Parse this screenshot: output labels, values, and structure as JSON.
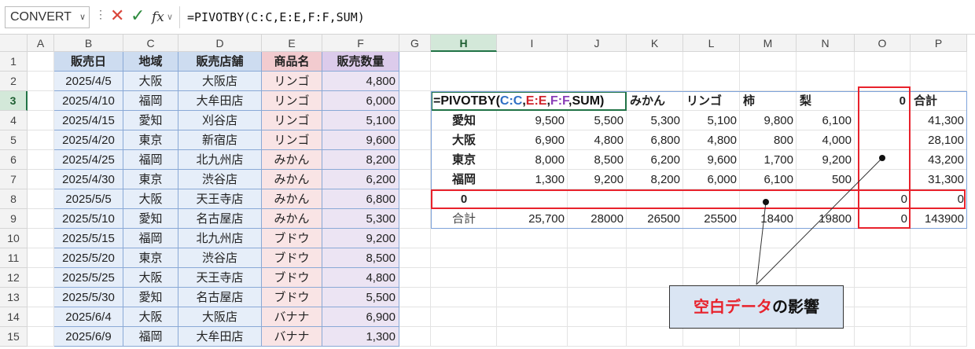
{
  "formula_bar": {
    "name_box": "CONVERT",
    "formula": "=PIVOTBY(C:C,E:E,F:F,SUM)"
  },
  "columns": [
    "A",
    "B",
    "C",
    "D",
    "E",
    "F",
    "G",
    "H",
    "I",
    "J",
    "K",
    "L",
    "M",
    "N",
    "O",
    "P"
  ],
  "selected_column": "H",
  "selected_row": "3",
  "rows": [
    "1",
    "2",
    "3",
    "4",
    "5",
    "6",
    "7",
    "8",
    "9",
    "10",
    "11",
    "12",
    "13",
    "14",
    "15"
  ],
  "table": {
    "headers": [
      "販売日",
      "地域",
      "販売店舗",
      "商品名",
      "販売数量"
    ],
    "data": [
      [
        "2025/4/5",
        "大阪",
        "大阪店",
        "リンゴ",
        "4,800"
      ],
      [
        "2025/4/10",
        "福岡",
        "大牟田店",
        "リンゴ",
        "6,000"
      ],
      [
        "2025/4/15",
        "愛知",
        "刈谷店",
        "リンゴ",
        "5,100"
      ],
      [
        "2025/4/20",
        "東京",
        "新宿店",
        "リンゴ",
        "9,600"
      ],
      [
        "2025/4/25",
        "福岡",
        "北九州店",
        "みかん",
        "8,200"
      ],
      [
        "2025/4/30",
        "東京",
        "渋谷店",
        "みかん",
        "6,200"
      ],
      [
        "2025/5/5",
        "大阪",
        "天王寺店",
        "みかん",
        "6,800"
      ],
      [
        "2025/5/10",
        "愛知",
        "名古屋店",
        "みかん",
        "5,300"
      ],
      [
        "2025/5/15",
        "福岡",
        "北九州店",
        "ブドウ",
        "9,200"
      ],
      [
        "2025/5/20",
        "東京",
        "渋谷店",
        "ブドウ",
        "8,500"
      ],
      [
        "2025/5/25",
        "大阪",
        "天王寺店",
        "ブドウ",
        "4,800"
      ],
      [
        "2025/5/30",
        "愛知",
        "名古屋店",
        "ブドウ",
        "5,500"
      ],
      [
        "2025/6/4",
        "大阪",
        "大阪店",
        "バナナ",
        "6,900"
      ],
      [
        "2025/6/9",
        "福岡",
        "大牟田店",
        "バナナ",
        "1,300"
      ]
    ]
  },
  "pivot": {
    "formula_prefix": "=PIVOTBY(",
    "formula_c": "C:C",
    "comma1": ",",
    "formula_e": "E:E",
    "comma2": ",",
    "formula_f": "F:F",
    "formula_suffix": ",SUM)",
    "col_headers": [
      "みかん",
      "リンゴ",
      "柿",
      "梨",
      "0",
      "合計"
    ],
    "rows": [
      {
        "label": "愛知",
        "values": [
          "9,500",
          "5,500",
          "5,300",
          "5,100",
          "9,800",
          "6,100",
          "",
          "41,300"
        ]
      },
      {
        "label": "大阪",
        "values": [
          "6,900",
          "4,800",
          "6,800",
          "4,800",
          "800",
          "4,000",
          "",
          "28,100"
        ]
      },
      {
        "label": "東京",
        "values": [
          "8,000",
          "8,500",
          "6,200",
          "9,600",
          "1,700",
          "9,200",
          "",
          "43,200"
        ]
      },
      {
        "label": "福岡",
        "values": [
          "1,300",
          "9,200",
          "8,200",
          "6,000",
          "6,100",
          "500",
          "",
          "31,300"
        ]
      },
      {
        "label": "0",
        "values": [
          "",
          "",
          "",
          "",
          "",
          "",
          "0",
          "0"
        ]
      },
      {
        "label": "合計",
        "values": [
          "25,700",
          "28000",
          "26500",
          "25500",
          "18400",
          "19800",
          "0",
          "143900"
        ]
      }
    ]
  },
  "callout": {
    "red_text": "空白データ",
    "black_text": "の影響"
  },
  "colors": {
    "red_highlight": "#e8222c",
    "selection_green": "#217346",
    "callout_bg": "#dae5f3"
  }
}
